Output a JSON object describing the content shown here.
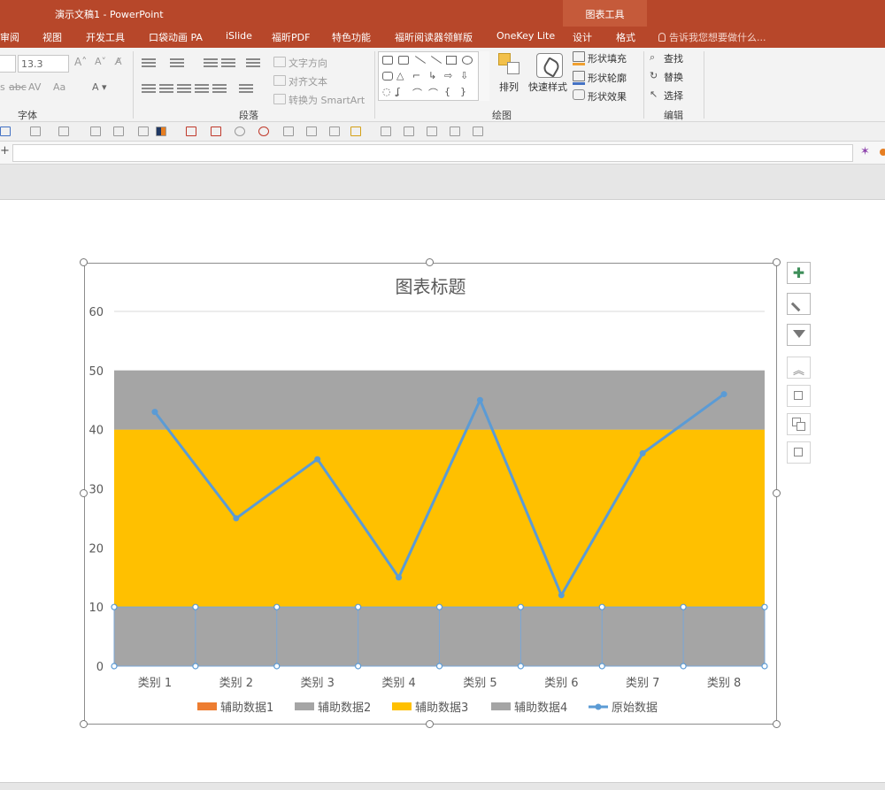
{
  "window": {
    "title": "演示文稿1 - PowerPoint",
    "contextual_group": "图表工具"
  },
  "tabs": [
    "审阅",
    "视图",
    "开发工具",
    "口袋动画 PA",
    "iSlide",
    "福昕PDF",
    "特色功能",
    "福昕阅读器领鲜版",
    "OneKey Lite",
    "设计",
    "格式"
  ],
  "tell_me": "告诉我您想要做什么...",
  "ribbon": {
    "font_size": "13.3",
    "groups": {
      "font": "字体",
      "paragraph": "段落",
      "drawing": "绘图",
      "editing": "编辑"
    },
    "paragraph": {
      "text_direction": "文字方向",
      "align_text": "对齐文本",
      "convert_smartart": "转换为 SmartArt"
    },
    "drawing": {
      "arrange": "排列",
      "quick_styles": "快速样式",
      "shape_fill": "形状填充",
      "shape_outline": "形状轮廓",
      "shape_effects": "形状效果"
    },
    "editing": {
      "find": "查找",
      "replace": "替换",
      "select": "选择"
    }
  },
  "chart_data": {
    "type": "line",
    "title": "图表标题",
    "categories": [
      "类别 1",
      "类别 2",
      "类别 3",
      "类别 4",
      "类别 5",
      "类别 6",
      "类别 7",
      "类别 8"
    ],
    "ylim": [
      0,
      60
    ],
    "yticks": [
      0,
      10,
      20,
      30,
      40,
      50,
      60
    ],
    "grid": true,
    "legend_position": "bottom",
    "stacked_area_series": [
      {
        "name": "辅助数据1",
        "color": "#ed7d31",
        "values": [
          0,
          0,
          0,
          0,
          0,
          0,
          0,
          0
        ]
      },
      {
        "name": "辅助数据2",
        "color": "#a5a5a5",
        "values": [
          10,
          10,
          10,
          10,
          10,
          10,
          10,
          10
        ]
      },
      {
        "name": "辅助数据3",
        "color": "#ffc000",
        "values": [
          30,
          30,
          30,
          30,
          30,
          30,
          30,
          30
        ]
      },
      {
        "name": "辅助数据4",
        "color": "#a5a5a5",
        "values": [
          10,
          10,
          10,
          10,
          10,
          10,
          10,
          10
        ]
      }
    ],
    "line_series": {
      "name": "原始数据",
      "color": "#5b9bd5",
      "values": [
        43,
        25,
        35,
        15,
        45,
        12,
        36,
        46
      ]
    }
  }
}
